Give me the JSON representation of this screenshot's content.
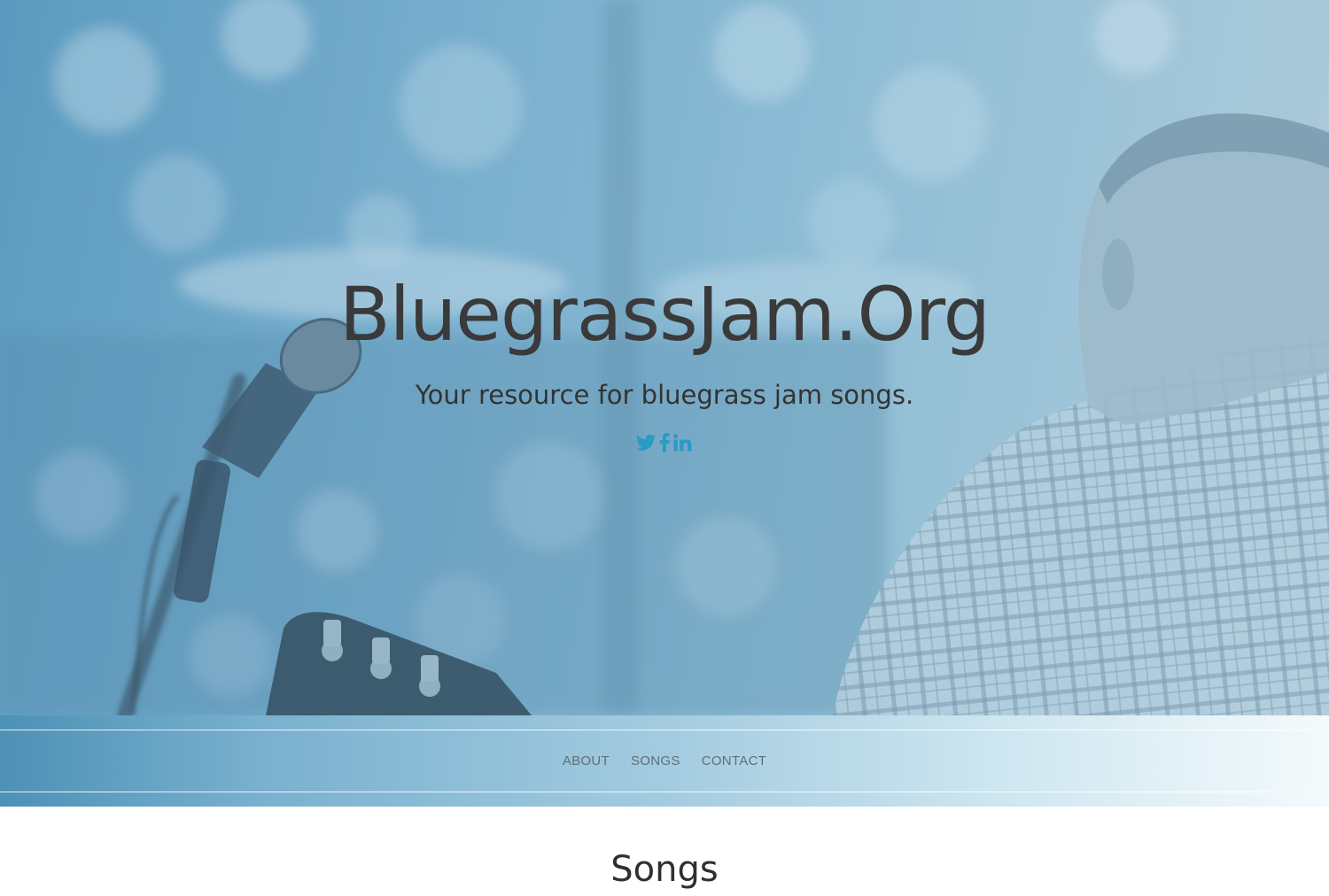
{
  "hero": {
    "title": "BluegrassJam.Org",
    "tagline": "Your resource for bluegrass jam songs.",
    "social": [
      {
        "icon": "twitter-icon"
      },
      {
        "icon": "facebook-icon"
      },
      {
        "icon": "linkedin-icon"
      }
    ],
    "accent_color": "#2a9ac6"
  },
  "nav": {
    "items": [
      {
        "label": "ABOUT"
      },
      {
        "label": "SONGS"
      },
      {
        "label": "CONTACT"
      }
    ]
  },
  "songs_section": {
    "title": "Songs"
  }
}
